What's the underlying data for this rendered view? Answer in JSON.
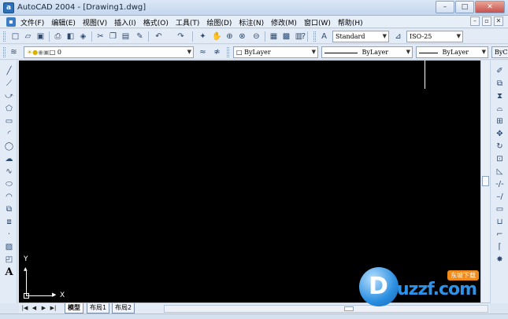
{
  "window": {
    "title": "AutoCAD 2004 - [Drawing1.dwg]",
    "app_icon_letter": "a",
    "buttons": {
      "minimize": "–",
      "maximize": "□",
      "close": "✕"
    }
  },
  "menubar": {
    "items": [
      "文件(F)",
      "编辑(E)",
      "视图(V)",
      "插入(I)",
      "格式(O)",
      "工具(T)",
      "绘图(D)",
      "标注(N)",
      "修改(M)",
      "窗口(W)",
      "帮助(H)"
    ],
    "doc_buttons": {
      "minimize": "–",
      "restore": "▫",
      "close": "✕"
    }
  },
  "standard_toolbar": {
    "text_style": "Standard",
    "dim_style": "ISO-25"
  },
  "layers_toolbar": {
    "layer": "0",
    "color": "ByLayer",
    "linetype": "ByLayer",
    "lineweight": "ByLayer",
    "plot_style": "ByC"
  },
  "draw_toolbar": {
    "text_tool_glyph": "A"
  },
  "ucs": {
    "x_label": "X",
    "y_label": "Y"
  },
  "tabs": [
    {
      "label": "模型",
      "active": true
    },
    {
      "label": "布局1",
      "active": false
    },
    {
      "label": "布局2",
      "active": false
    }
  ],
  "watermark": {
    "badge_letter": "D",
    "tag": "东坡下载",
    "text": "uzzf.com"
  },
  "colors": {
    "canvas": "#000000",
    "toolbar_bg": "#e3ebf6",
    "title_bar": "#c4d6ee"
  }
}
